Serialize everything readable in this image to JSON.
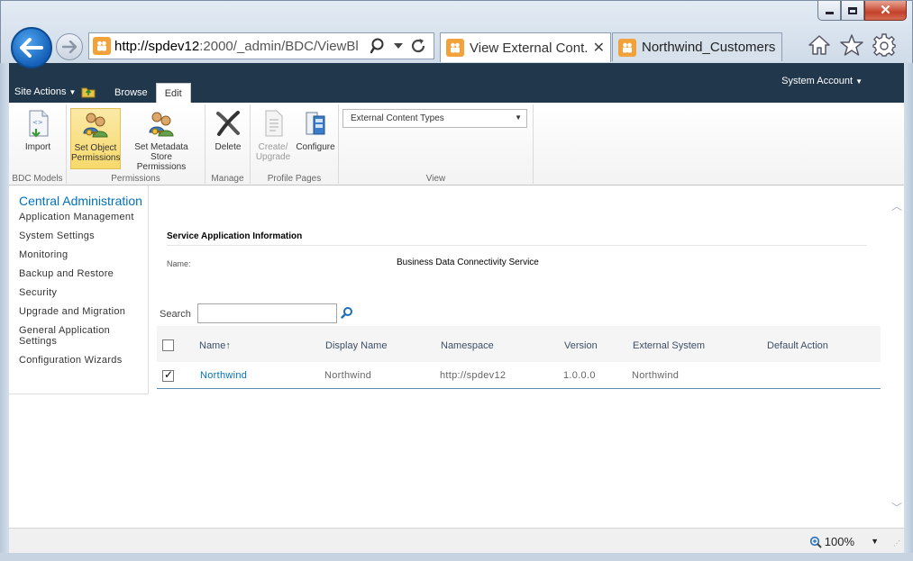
{
  "browser": {
    "url_host": "http://spdev12",
    "url_rest": ":2000/_admin/BDC/ViewBl",
    "tabs": [
      {
        "label": "View External Cont...",
        "active": true
      },
      {
        "label": "Northwind_Customers...",
        "active": false
      }
    ],
    "zoom": "100%"
  },
  "ribbon": {
    "site_actions": "Site Actions",
    "tabs": [
      "Browse",
      "Edit"
    ],
    "selected_tab": "Edit",
    "account": "System Account",
    "groups": {
      "bdc_models": {
        "title": "BDC Models",
        "import": "Import"
      },
      "permissions": {
        "title": "Permissions",
        "set_object_1": "Set Object",
        "set_object_2": "Permissions",
        "set_metadata_1": "Set Metadata Store",
        "set_metadata_2": "Permissions"
      },
      "manage": {
        "title": "Manage",
        "delete": "Delete"
      },
      "profile_pages": {
        "title": "Profile Pages",
        "create_1": "Create/",
        "create_2": "Upgrade",
        "configure": "Configure"
      },
      "view": {
        "title": "View",
        "selected": "External Content Types"
      }
    }
  },
  "leftnav": {
    "head": "Central Administration",
    "items": [
      "Application Management",
      "System Settings",
      "Monitoring",
      "Backup and Restore",
      "Security",
      "Upgrade and Migration",
      "General Application Settings",
      "Configuration Wizards"
    ]
  },
  "service": {
    "title": "Service Application Information",
    "name_label": "Name:",
    "name_value": "Business Data Connectivity Service"
  },
  "search": {
    "label": "Search",
    "value": ""
  },
  "grid": {
    "headers": {
      "name": "Name",
      "sort": "↑",
      "display_name": "Display Name",
      "namespace": "Namespace",
      "version": "Version",
      "external_system": "External System",
      "default_action": "Default Action"
    },
    "rows": [
      {
        "name": "Northwind",
        "display_name": "Northwind",
        "namespace": "http://spdev12",
        "version": "1.0.0.0",
        "external_system": "Northwind",
        "default_action": "",
        "checked": true
      }
    ]
  },
  "colors": {
    "accent": "#0072bc",
    "ribbon_dark": "#21374c",
    "selected_button": "#f7d96b"
  }
}
